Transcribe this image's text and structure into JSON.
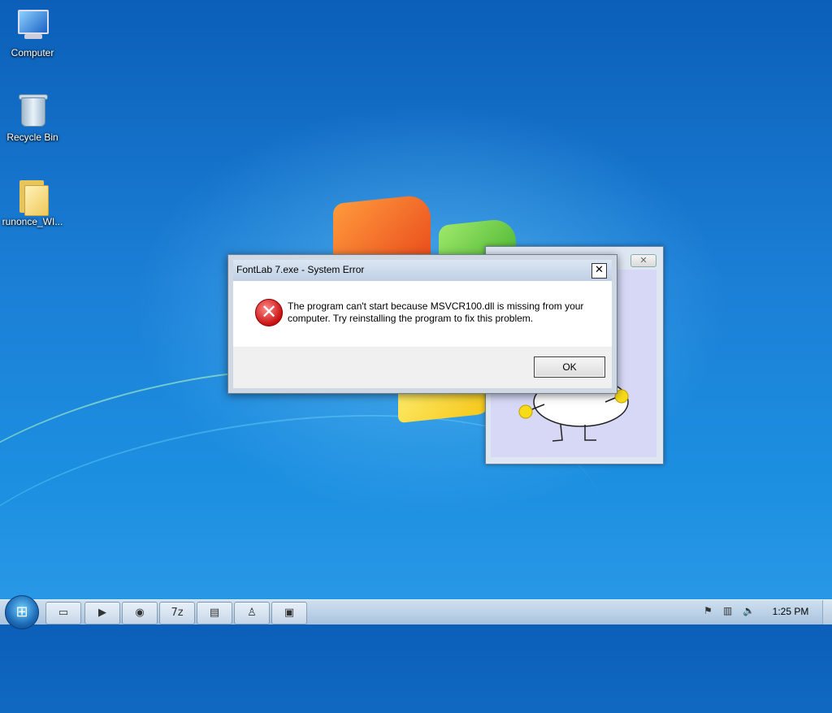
{
  "desktop": {
    "icons": [
      {
        "label": "Computer",
        "icon": "computer-icon"
      },
      {
        "label": "Recycle Bin",
        "icon": "recycle-bin-icon"
      },
      {
        "label": "runonce_WI...",
        "icon": "folder-icon"
      }
    ]
  },
  "background_window": {
    "close_glyph": "✕"
  },
  "dialog": {
    "title": "FontLab 7.exe - System Error",
    "close_glyph": "✕",
    "message": "The program can't start because MSVCR100.dll is missing from your computer. Try reinstalling the program to fix this problem.",
    "ok_label": "OK",
    "icon": "error-icon"
  },
  "taskbar": {
    "start_glyph": "⊞",
    "pinned": [
      {
        "icon": "explorer-icon",
        "glyph": "▭"
      },
      {
        "icon": "media-player-icon",
        "glyph": "▶"
      },
      {
        "icon": "chrome-icon",
        "glyph": "◉"
      },
      {
        "icon": "7zip-icon",
        "glyph": "7z"
      },
      {
        "icon": "notepad-icon",
        "glyph": "▤"
      },
      {
        "icon": "fontlab-icon",
        "glyph": "♙"
      },
      {
        "icon": "window-icon",
        "glyph": "▣"
      }
    ],
    "tray": [
      {
        "icon": "action-center-icon",
        "glyph": "⚑"
      },
      {
        "icon": "network-icon",
        "glyph": "▥"
      },
      {
        "icon": "volume-icon",
        "glyph": "🔈"
      }
    ],
    "clock": "1:25 PM"
  }
}
